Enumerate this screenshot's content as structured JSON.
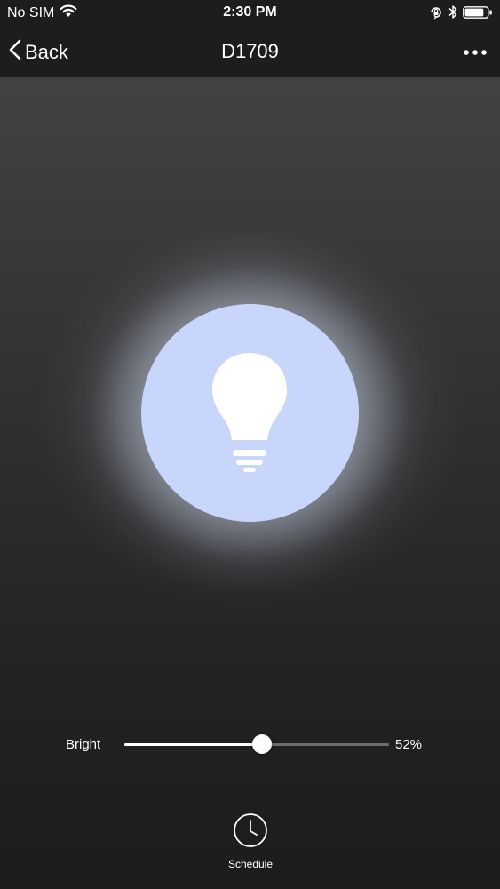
{
  "status_bar": {
    "carrier": "No SIM",
    "time": "2:30 PM",
    "icons": [
      "wifi-icon",
      "orientation-lock-icon",
      "bluetooth-icon",
      "battery-icon"
    ],
    "battery_level": 0.85
  },
  "nav": {
    "back_label": "Back",
    "title": "D1709",
    "more_icon": "more-dots-icon"
  },
  "bulb": {
    "icon": "lightbulb-icon",
    "circle_color": "#c9d6fb",
    "glow_color": "#e1e8fa"
  },
  "brightness": {
    "label": "Bright",
    "value": 52,
    "value_label": "52%"
  },
  "schedule": {
    "icon": "clock-icon",
    "label": "Schedule"
  },
  "colors": {
    "bar_background": "#1d1d1d",
    "text": "#ffffff",
    "slider_track": "#6d6d6d",
    "slider_fill": "#ffffff"
  }
}
